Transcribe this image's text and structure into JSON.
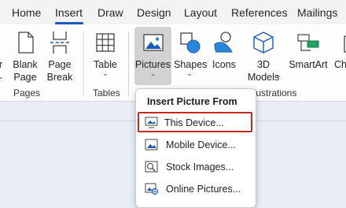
{
  "tabs": [
    {
      "label": "Home"
    },
    {
      "label": "Insert",
      "active": true
    },
    {
      "label": "Draw"
    },
    {
      "label": "Design"
    },
    {
      "label": "Layout"
    },
    {
      "label": "References"
    },
    {
      "label": "Mailings"
    }
  ],
  "ribbon": {
    "pages": {
      "blank_page": {
        "line1": "Blank",
        "line2": "Page"
      },
      "page_break": {
        "line1": "Page",
        "line2": "Break"
      },
      "cut_left_line1": "r",
      "group_label": "Pages"
    },
    "tables": {
      "label": "Table",
      "group_label": "Tables"
    },
    "illustrations": {
      "pictures": "Pictures",
      "shapes": "Shapes",
      "icons": "Icons",
      "models": {
        "line1": "3D",
        "line2": "Models"
      },
      "smartart": "SmartArt",
      "chart_cut": "Ch",
      "group_label": "llustrations"
    }
  },
  "dropdown": {
    "title": "Insert Picture From",
    "items": [
      {
        "label": "This Device...",
        "icon": "device-icon",
        "selected": true
      },
      {
        "label": "Mobile Device...",
        "icon": "mobile-device-icon"
      },
      {
        "label": "Stock Images...",
        "icon": "stock-images-icon"
      },
      {
        "label": "Online Pictures...",
        "icon": "online-pictures-icon"
      }
    ]
  },
  "colors": {
    "accent": "#185abd",
    "highlight_border": "#c42b1c",
    "ribbon_bg": "#fdfdfd",
    "doc_bg": "#e9eef6"
  }
}
